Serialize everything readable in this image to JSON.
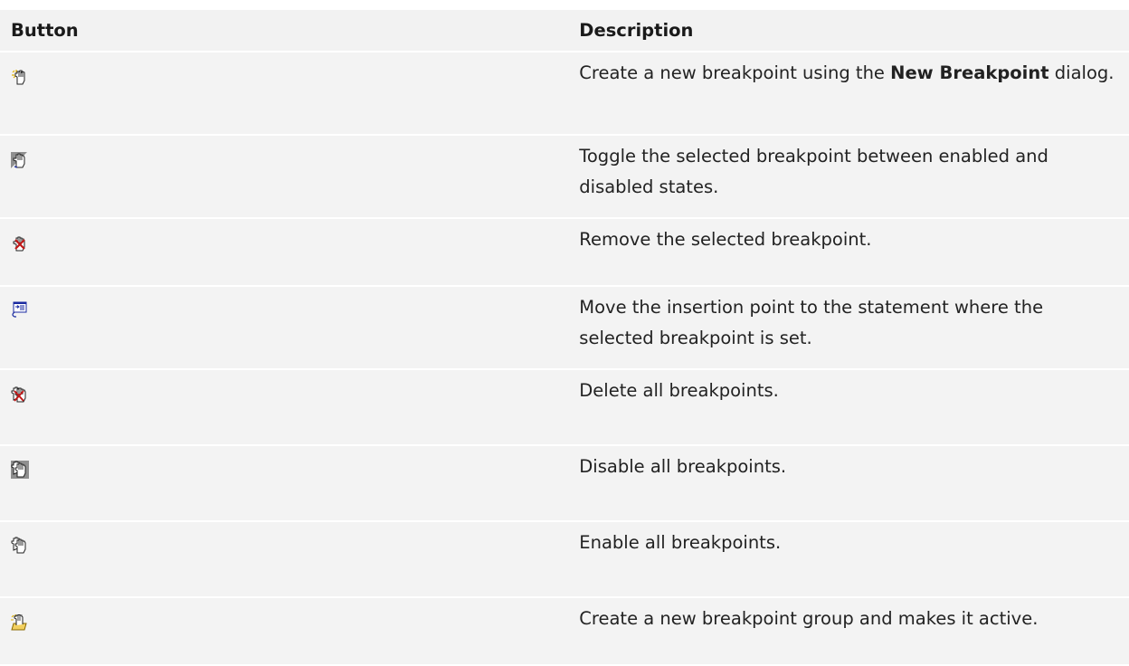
{
  "table": {
    "headers": [
      "Button",
      "Description"
    ],
    "rows": [
      {
        "icon": "new-breakpoint-hand-icon",
        "text_before": "Create a new breakpoint using the ",
        "bold": "New Breakpoint",
        "text_after": " dialog."
      },
      {
        "icon": "toggle-breakpoint-hand-icon",
        "text": "Toggle the selected breakpoint between enabled and disabled states."
      },
      {
        "icon": "remove-breakpoint-hand-icon",
        "text": "Remove the selected breakpoint."
      },
      {
        "icon": "goto-statement-icon",
        "text": "Move the insertion point to the statement where the selected breakpoint is set."
      },
      {
        "icon": "delete-all-breakpoints-icon",
        "text": "Delete all breakpoints."
      },
      {
        "icon": "disable-all-breakpoints-icon",
        "text": "Disable all breakpoints."
      },
      {
        "icon": "enable-all-breakpoints-icon",
        "text": "Enable all breakpoints."
      },
      {
        "icon": "new-breakpoint-group-icon",
        "text": "Create a new breakpoint group and makes it active."
      }
    ]
  }
}
